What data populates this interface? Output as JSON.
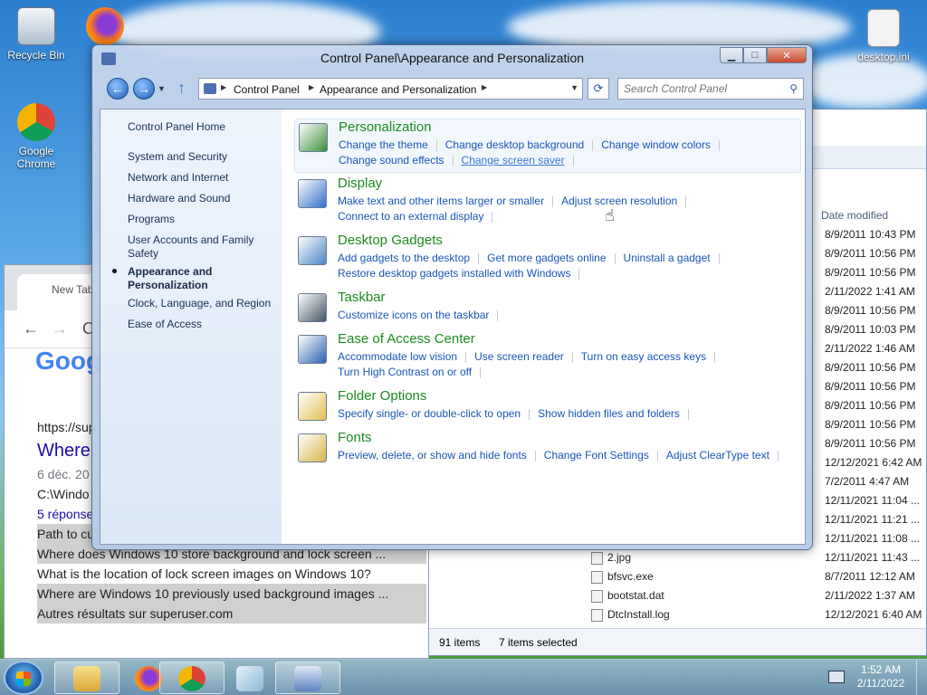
{
  "desktop": {
    "icons": [
      {
        "label": "Recycle Bin"
      },
      {
        "label": "Google Chrome"
      },
      {
        "label": "desktop.ini"
      }
    ]
  },
  "explorer": {
    "column_date": "Date modified",
    "rows": [
      {
        "name": "",
        "date": "8/9/2011 10:43 PM"
      },
      {
        "name": "",
        "date": "8/9/2011 10:56 PM"
      },
      {
        "name": "",
        "date": "8/9/2011 10:56 PM"
      },
      {
        "name": "",
        "date": "2/11/2022 1:41 AM"
      },
      {
        "name": "",
        "date": "8/9/2011 10:56 PM"
      },
      {
        "name": "",
        "date": "8/9/2011 10:03 PM"
      },
      {
        "name": "",
        "date": "2/11/2022 1:46 AM"
      },
      {
        "name": "",
        "date": "8/9/2011 10:56 PM"
      },
      {
        "name": "",
        "date": "8/9/2011 10:56 PM"
      },
      {
        "name": "",
        "date": "8/9/2011 10:56 PM"
      },
      {
        "name": "",
        "date": "8/9/2011 10:56 PM"
      },
      {
        "name": "",
        "date": "8/9/2011 10:56 PM"
      },
      {
        "name": "",
        "date": "12/12/2021 6:42 AM"
      },
      {
        "name": "",
        "date": "7/2/2011 4:47 AM"
      },
      {
        "name": "",
        "date": "12/11/2021 11:04 ..."
      },
      {
        "name": "",
        "date": "12/11/2021 11:21 ..."
      },
      {
        "name": "",
        "date": "12/11/2021 11:08 ..."
      },
      {
        "name": "2.jpg",
        "date": "12/11/2021 11:43 ..."
      },
      {
        "name": "bfsvc.exe",
        "date": "8/7/2011 12:12 AM"
      },
      {
        "name": "bootstat.dat",
        "date": "2/11/2022 1:37 AM"
      },
      {
        "name": "DtcInstall.log",
        "date": "12/12/2021 6:40 AM"
      }
    ],
    "status_items": "91 items",
    "status_selected": "7 items selected"
  },
  "chrome": {
    "tab_title": "New Tab",
    "logo_text": "Goog",
    "results": [
      {
        "text": "https://sup"
      },
      {
        "text": "Where"
      },
      {
        "text": "6 déc. 20"
      },
      {
        "text": "C:\\Windo"
      },
      {
        "text": "5 réponse"
      },
      {
        "text": "Path to cu"
      },
      {
        "text": "Where does Windows 10 store background and lock screen ..."
      },
      {
        "text": "What is the location of lock screen images on Windows 10?"
      },
      {
        "text": "Where are Windows 10 previously used background images ..."
      },
      {
        "text": "Autres résultats sur superuser.com"
      }
    ]
  },
  "control_panel": {
    "title": "Control Panel\\Appearance and Personalization",
    "address": {
      "seg1": "Control Panel",
      "seg2": "Appearance and Personalization"
    },
    "search_placeholder": "Search Control Panel",
    "sidebar": {
      "home": "Control Panel Home",
      "items": [
        "System and Security",
        "Network and Internet",
        "Hardware and Sound",
        "Programs",
        "User Accounts and Family Safety",
        "Appearance and Personalization",
        "Clock, Language, and Region",
        "Ease of Access"
      ]
    },
    "categories": [
      {
        "title": "Personalization",
        "icon_color": "#3a8f3a",
        "links": [
          "Change the theme",
          "Change desktop background",
          "Change window colors",
          "Change sound effects",
          "Change screen saver"
        ]
      },
      {
        "title": "Display",
        "icon_color": "#2f6fc9",
        "links": [
          "Make text and other items larger or smaller",
          "Adjust screen resolution",
          "Connect to an external display"
        ]
      },
      {
        "title": "Desktop Gadgets",
        "icon_color": "#4a86c5",
        "links": [
          "Add gadgets to the desktop",
          "Get more gadgets online",
          "Uninstall a gadget",
          "Restore desktop gadgets installed with Windows"
        ]
      },
      {
        "title": "Taskbar",
        "icon_color": "#445566",
        "links": [
          "Customize icons on the taskbar"
        ]
      },
      {
        "title": "Ease of Access Center",
        "icon_color": "#2a62b0",
        "links": [
          "Accommodate low vision",
          "Use screen reader",
          "Turn on easy access keys",
          "Turn High Contrast on or off"
        ]
      },
      {
        "title": "Folder Options",
        "icon_color": "#e2c050",
        "links": [
          "Specify single- or double-click to open",
          "Show hidden files and folders"
        ]
      },
      {
        "title": "Fonts",
        "icon_color": "#d9b54a",
        "links": [
          "Preview, delete, or show and hide fonts",
          "Change Font Settings",
          "Adjust ClearType text"
        ]
      }
    ]
  },
  "taskbar": {
    "time": "1:52 AM",
    "date": "2/11/2022"
  },
  "colors": {
    "link": "#1a55b8",
    "category_title": "#1e8a20"
  }
}
